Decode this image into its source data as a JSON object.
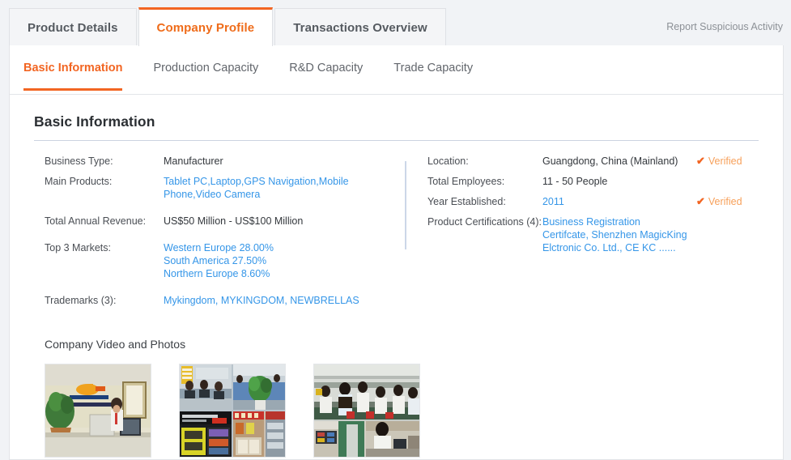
{
  "header": {
    "tabs": [
      {
        "label": "Product Details",
        "active": false
      },
      {
        "label": "Company Profile",
        "active": true
      },
      {
        "label": "Transactions Overview",
        "active": false
      }
    ],
    "report_link": "Report Suspicious Activity"
  },
  "subtabs": [
    {
      "label": "Basic Information",
      "active": true
    },
    {
      "label": "Production Capacity",
      "active": false
    },
    {
      "label": "R&D Capacity",
      "active": false
    },
    {
      "label": "Trade Capacity",
      "active": false
    }
  ],
  "section": {
    "title": "Basic Information"
  },
  "info": {
    "left": [
      {
        "label": "Business Type:",
        "value": "Manufacturer",
        "link": false
      },
      {
        "label": "Main Products:",
        "value": "Tablet PC,Laptop,GPS Navigation,Mobile Phone,Video Camera",
        "link": true
      },
      {
        "label": "Total Annual Revenue:",
        "value": "US$50 Million - US$100 Million",
        "link": false
      },
      {
        "label": "Top 3 Markets:",
        "lines": [
          "Western Europe 28.00%",
          "South America 27.50%",
          "Northern Europe 8.60%"
        ],
        "link": true
      },
      {
        "label": "Trademarks (3):",
        "value": "Mykingdom, MYKINGDOM, NEWBRELLAS",
        "link": true
      }
    ],
    "right": [
      {
        "label": "Location:",
        "value": "Guangdong, China (Mainland)",
        "link": false,
        "verified": "Verified"
      },
      {
        "label": "Total Employees:",
        "value": "11 - 50 People",
        "link": false,
        "verified": ""
      },
      {
        "label": "Year Established:",
        "value": "2011",
        "link": true,
        "verified": "Verified"
      },
      {
        "label": "Product Certifications (4):",
        "value": "Business Registration Certifcate, Shenzhen MagicKing Elctronic Co. Ltd., CE KC ......",
        "link": true,
        "verified": ""
      }
    ],
    "verified_tick": "✔"
  },
  "media": {
    "title": "Company Video and Photos",
    "photos": [
      {
        "name": "company-reception-photo",
        "alt": "Reception desk with staff member and company logo wall"
      },
      {
        "name": "company-office-showroom-photo",
        "alt": "Collage of office workstations and product showroom displays"
      },
      {
        "name": "company-production-line-photo",
        "alt": "Collage of factory assembly line workers and repair bench"
      }
    ]
  },
  "colors": {
    "accent": "#f26522",
    "link": "#3596e8",
    "verified_text": "#f7a05a",
    "page_bg": "#f1f3f6",
    "divider": "#ccd7e8"
  }
}
